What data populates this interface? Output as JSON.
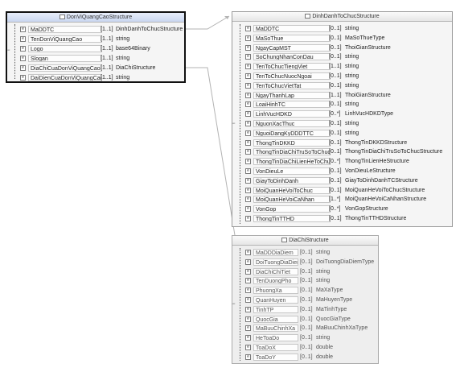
{
  "boxes": {
    "don_vi": {
      "title": "DonViQuangCaoStructure",
      "rows": [
        {
          "name": "MaDDTC",
          "card": "[1..1]",
          "type": "DinhDanhToChucStructure"
        },
        {
          "name": "TenDonViQuangCao",
          "card": "[1..1]",
          "type": "string"
        },
        {
          "name": "Logo",
          "card": "[1..1]",
          "type": "base64Binary"
        },
        {
          "name": "Slogan",
          "card": "[1..1]",
          "type": "string"
        },
        {
          "name": "DiaChiCuaDonViQuangCao",
          "card": "[1..1]",
          "type": "DiaChiStructure"
        },
        {
          "name": "DaiDienCuaDonViQuangCao",
          "card": "[1..1]",
          "type": "string"
        }
      ]
    },
    "dinh_danh": {
      "title": "DinhDanhToChucStructure",
      "rows": [
        {
          "name": "MaDDTC",
          "card": "[0..1]",
          "type": "string"
        },
        {
          "name": "MaSoThue",
          "card": "[0..1]",
          "type": "MaSoThueType"
        },
        {
          "name": "NgayCapMST",
          "card": "[0..1]",
          "type": "ThoiGianStructure"
        },
        {
          "name": "SoChungNhanConDau",
          "card": "[0..1]",
          "type": "string"
        },
        {
          "name": "TenToChucTiengViet",
          "card": "[1..1]",
          "type": "string"
        },
        {
          "name": "TenToChucNuocNgoai",
          "card": "[0..1]",
          "type": "string"
        },
        {
          "name": "TenToChucVietTat",
          "card": "[0..1]",
          "type": "string"
        },
        {
          "name": "NgayThanhLap",
          "card": "[1..1]",
          "type": "ThoiGianStructure"
        },
        {
          "name": "LoaiHinhTC",
          "card": "[0..1]",
          "type": "string"
        },
        {
          "name": "LinhVucHDKD",
          "card": "[0..*]",
          "type": "LinhVucHDKDType"
        },
        {
          "name": "NguonXacThuc",
          "card": "[0..1]",
          "type": "string"
        },
        {
          "name": "NguoiDangKyDDDTTC",
          "card": "[0..1]",
          "type": "string"
        },
        {
          "name": "ThongTinDKKD",
          "card": "[0..1]",
          "type": "ThongTinDKKDStructure"
        },
        {
          "name": "ThongTinDiaChiTruSoToChuc",
          "card": "[0..1]",
          "type": "ThongTinDiaChiTruSoToChucStructure"
        },
        {
          "name": "ThongTinDiaChiLienHeToChuc",
          "card": "[0..*]",
          "type": "ThongTinLienHeStructure"
        },
        {
          "name": "VonDieuLe",
          "card": "[0..1]",
          "type": "VonDieuLeStructure"
        },
        {
          "name": "GiayToDinhDanh",
          "card": "[0..1]",
          "type": "GiayToDinhDanhTCStructure"
        },
        {
          "name": "MoiQuanHeVoiToChuc",
          "card": "[0..1]",
          "type": "MoiQuanHeVoiToChucStructure"
        },
        {
          "name": "MoiQuanHeVoiCaNhan",
          "card": "[1..*]",
          "type": "MoiQuanHeVoiCaNhanStructure"
        },
        {
          "name": "VonGop",
          "card": "[0..*]",
          "type": "VonGopStructure"
        },
        {
          "name": "ThongTinTTHD",
          "card": "[0..1]",
          "type": "ThongTinTTHDStructure"
        }
      ]
    },
    "dia_chi": {
      "title": "DiaChiStructure",
      "rows": [
        {
          "name": "MaDDDiaDiem",
          "card": "[0..1]",
          "type": "string"
        },
        {
          "name": "DoiTuongDiaDiem",
          "card": "[0..1]",
          "type": "DoiTuongDiaDiemType"
        },
        {
          "name": "DiaChiChiTiet",
          "card": "[0..1]",
          "type": "string"
        },
        {
          "name": "TenDuongPho",
          "card": "[0..1]",
          "type": "string"
        },
        {
          "name": "PhuongXa",
          "card": "[0..1]",
          "type": "MaXaType"
        },
        {
          "name": "QuanHuyen",
          "card": "[0..1]",
          "type": "MaHuyenType"
        },
        {
          "name": "TinhTP",
          "card": "[0..1]",
          "type": "MaTinhType"
        },
        {
          "name": "QuocGia",
          "card": "[0..1]",
          "type": "QuocGiaType"
        },
        {
          "name": "MaBuuChinhXa",
          "card": "[0..1]",
          "type": "MaBuuChinhXaType"
        },
        {
          "name": "HeToaDo",
          "card": "[0..1]",
          "type": "string"
        },
        {
          "name": "ToaDoX",
          "card": "[0..1]",
          "type": "double"
        },
        {
          "name": "ToaDoY",
          "card": "[0..1]",
          "type": "double"
        }
      ]
    }
  },
  "icons": {
    "element": "element-icon",
    "header": "complex-type-icon"
  },
  "colors": {
    "border": "#9a9a9a",
    "selected_border": "#111111",
    "header_bg": "#e6e6e6",
    "connector": "#b0b0b0"
  }
}
